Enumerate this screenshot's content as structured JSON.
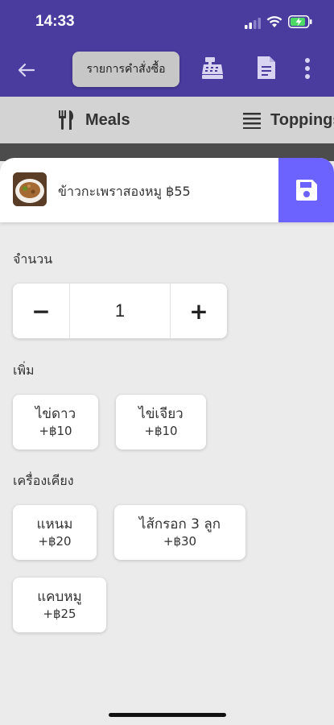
{
  "status_bar": {
    "time": "14:33"
  },
  "toolbar": {
    "order_list_label": "รายการคำสั่งซื้อ"
  },
  "tabs": [
    {
      "label": "Meals",
      "active": true
    },
    {
      "label": "Toppings",
      "active": false
    }
  ],
  "item": {
    "name": "ข้าวกะเพราสองหมู ฿55"
  },
  "quantity": {
    "label": "จำนวน",
    "value": "1",
    "minus": "−",
    "plus": "+"
  },
  "addons": {
    "label": "เพิ่ม",
    "options": [
      {
        "name": "ไข่ดาว",
        "price": "+฿10"
      },
      {
        "name": "ไข่เจียว",
        "price": "+฿10"
      }
    ]
  },
  "sides": {
    "label": "เครื่องเคียง",
    "options": [
      {
        "name": "แหนม",
        "price": "+฿20"
      },
      {
        "name": "ไส้กรอก 3 ลูก",
        "price": "+฿30"
      },
      {
        "name": "แคบหมู",
        "price": "+฿25"
      }
    ]
  },
  "colors": {
    "primary": "#4a3b9e",
    "accent": "#6c63ff",
    "background": "#ebebeb"
  },
  "icons": [
    "back-arrow-icon",
    "cash-register-icon",
    "document-icon",
    "more-vertical-icon",
    "fork-knife-icon",
    "list-icon",
    "save-icon"
  ]
}
